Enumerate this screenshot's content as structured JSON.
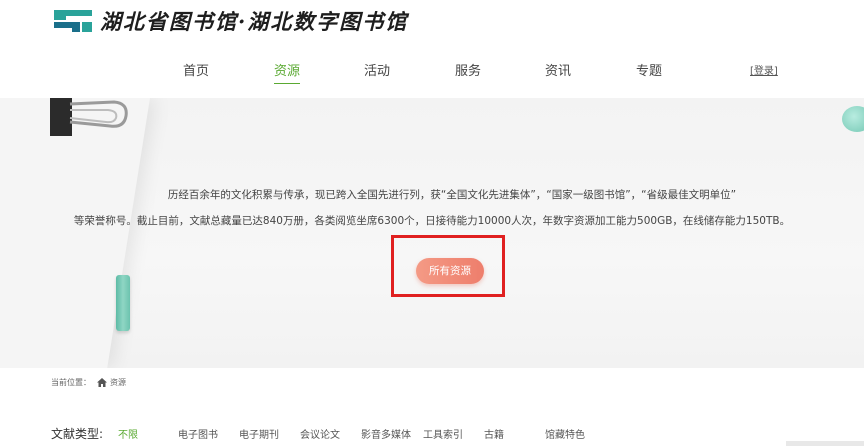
{
  "header": {
    "logo_text": "湖北省图书馆·湖北数字图书馆",
    "nav": [
      "首页",
      "资源",
      "活动",
      "服务",
      "资讯",
      "专题"
    ],
    "active_nav": "资源",
    "login_label": "[登录]"
  },
  "hero": {
    "description_line1": "历经百余年的文化积累与传承，现已跨入全国先进行列，获“全国文化先进集体”，“国家一级图书馆”，“省级最佳文明单位”",
    "description_line2": "等荣誉称号。截止目前，文献总藏量已达840万册，各类阅览坐席6300个，日接待能力10000人次，年数字资源加工能力500GB，在线储存能力150TB。",
    "all_resources_button": "所有资源"
  },
  "breadcrumb": {
    "prefix": "当前位置：",
    "current": "资源"
  },
  "filter": {
    "label": "文献类型:",
    "options": [
      "不限",
      "电子图书",
      "电子期刊",
      "会议论文",
      "影音多媒体",
      "工具索引",
      "古籍",
      "馆藏特色"
    ],
    "selected": "不限"
  },
  "colors": {
    "accent_green": "#5aa932",
    "button_salmon": "#f08a76",
    "highlight_red": "#e02020",
    "logo_teal": "#2aa39a"
  }
}
